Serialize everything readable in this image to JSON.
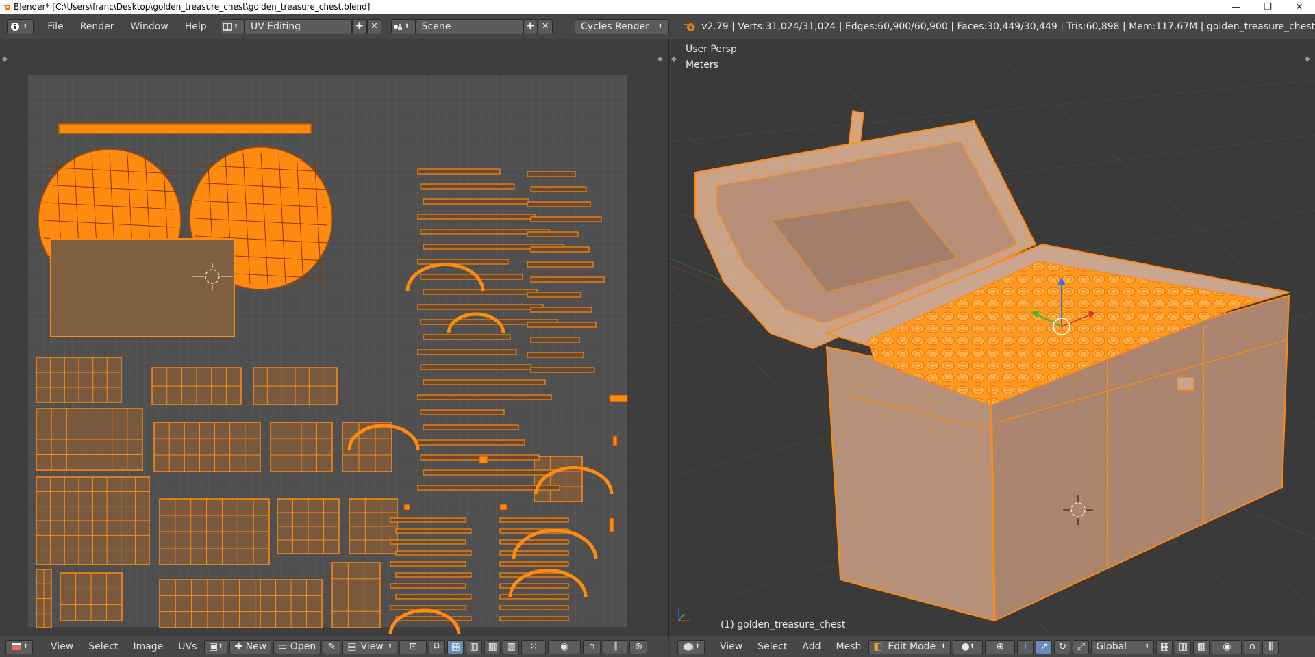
{
  "window": {
    "title": "Blender* [C:\\Users\\franc\\Desktop\\golden_treasure_chest\\golden_treasure_chest.blend]",
    "minimize_glyph": "—",
    "maximize_glyph": "❐",
    "close_glyph": "✕"
  },
  "header": {
    "menu": [
      "File",
      "Render",
      "Window",
      "Help"
    ],
    "screen_layout": "UV Editing",
    "scene": "Scene",
    "engine": "Cycles Render",
    "stats": "v2.79 | Verts:31,024/31,024 | Edges:60,900/60,900 | Faces:30,449/30,449 | Tris:60,898 | Mem:117.67M | golden_treasure_chest"
  },
  "viewport3d": {
    "view_name": "User Persp",
    "units": "Meters",
    "object_label": "(1) golden_treasure_chest"
  },
  "uv_footer": {
    "menus": [
      "View",
      "Select",
      "Image",
      "UVs"
    ],
    "new_label": "New",
    "open_label": "Open",
    "view_dropdown": "View"
  },
  "viewport_footer": {
    "menus": [
      "View",
      "Select",
      "Add",
      "Mesh"
    ],
    "mode": "Edit Mode",
    "orientation": "Global"
  },
  "colors": {
    "accent_orange": "#ff8a10",
    "uv_background": "#505050",
    "panel": "#464646"
  }
}
